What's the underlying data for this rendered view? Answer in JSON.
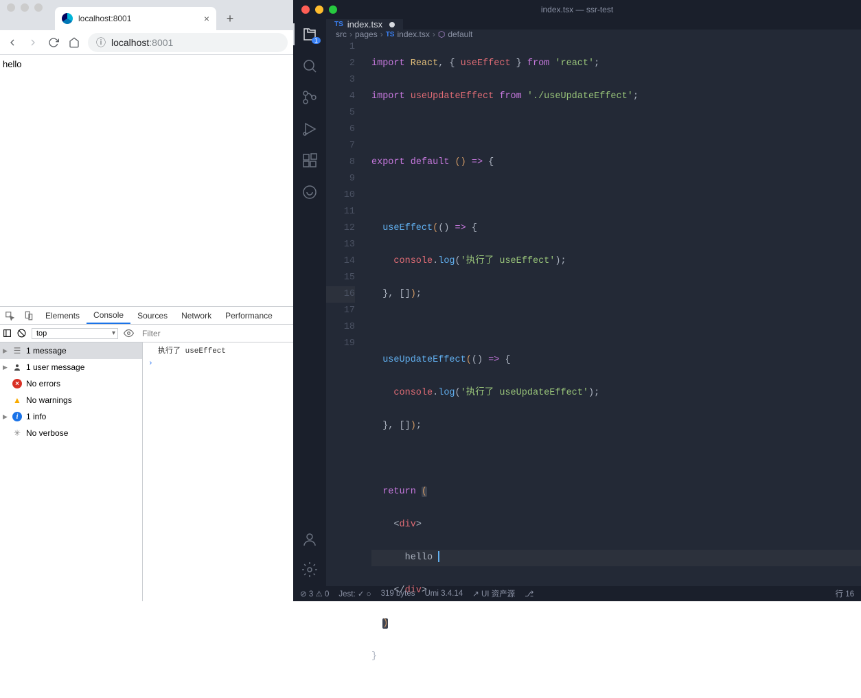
{
  "chrome": {
    "tab_title": "localhost:8001",
    "url_host": "localhost",
    "url_port": ":8001",
    "page_text": "hello"
  },
  "devtools": {
    "tabs": [
      "Elements",
      "Console",
      "Sources",
      "Network",
      "Performance"
    ],
    "active_tab": 1,
    "context": "top",
    "filter_placeholder": "Filter",
    "sidebar": [
      {
        "icon": "msg",
        "label": "1 message",
        "expandable": true,
        "active": true
      },
      {
        "icon": "user",
        "label": "1 user message",
        "expandable": true
      },
      {
        "icon": "err",
        "label": "No errors"
      },
      {
        "icon": "warn",
        "label": "No warnings"
      },
      {
        "icon": "info",
        "label": "1 info",
        "expandable": true
      },
      {
        "icon": "verb",
        "label": "No verbose"
      }
    ],
    "console_output": "执行了 useEffect"
  },
  "vscode": {
    "title": "index.tsx — ssr-test",
    "tab": {
      "lang": "TS",
      "name": "index.tsx"
    },
    "breadcrumb": [
      "src",
      "pages",
      "index.tsx",
      "default"
    ],
    "activity_badge": "1",
    "lines": [
      1,
      2,
      3,
      4,
      5,
      6,
      7,
      8,
      9,
      10,
      11,
      12,
      13,
      14,
      15,
      16,
      17,
      18,
      19
    ],
    "statusbar": {
      "errors": "3",
      "warnings": "0",
      "jest": "Jest: ",
      "bytes": "319 bytes",
      "umi": "Umi 3.4.14",
      "ui": "UI 资产源",
      "line": "行 16"
    }
  },
  "code_source": {
    "l1": "import React, { useEffect } from 'react';",
    "l2": "import useUpdateEffect from './useUpdateEffect';",
    "l4": "export default () => {",
    "l6": "  useEffect(() => {",
    "l7": "    console.log('执行了 useEffect');",
    "l8": "  }, []);",
    "l10": "  useUpdateEffect(() => {",
    "l11": "    console.log('执行了 useUpdateEffect');",
    "l12": "  }, []);",
    "l14": "  return (",
    "l15": "    <div>",
    "l16": "      hello ",
    "l17": "    </div>",
    "l18": "  )",
    "l19": "}"
  }
}
